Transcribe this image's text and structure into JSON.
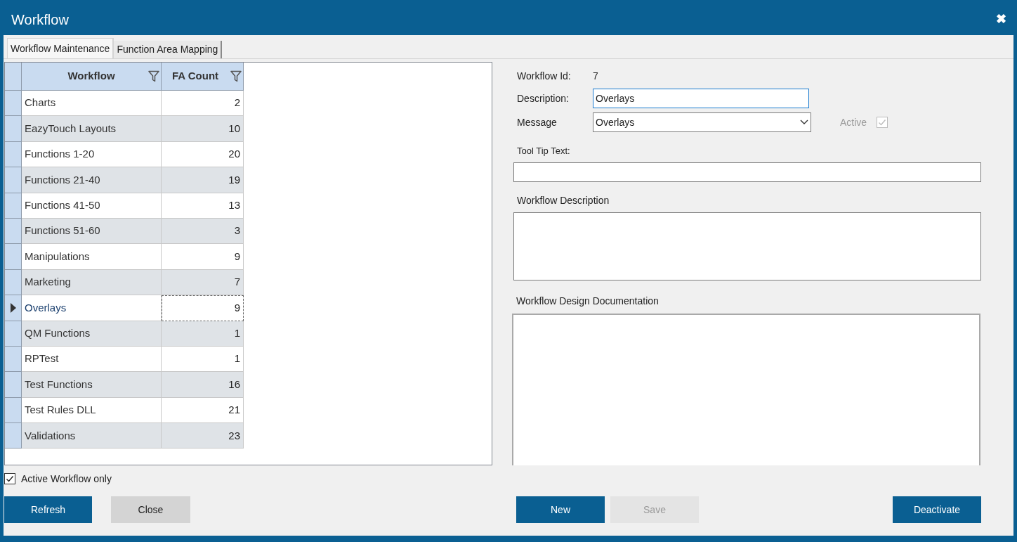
{
  "window": {
    "title": "Workflow",
    "close": "✖"
  },
  "tabs": [
    {
      "label": "Workflow Maintenance",
      "selected": true
    },
    {
      "label": "Function Area Mapping",
      "selected": false
    }
  ],
  "table": {
    "columns": [
      "Workflow",
      "FA Count"
    ],
    "rows": [
      {
        "workflow": "Charts",
        "fa_count": "2",
        "selected": false
      },
      {
        "workflow": "EazyTouch Layouts",
        "fa_count": "10",
        "selected": false
      },
      {
        "workflow": "Functions 1-20",
        "fa_count": "20",
        "selected": false
      },
      {
        "workflow": "Functions 21-40",
        "fa_count": "19",
        "selected": false
      },
      {
        "workflow": "Functions 41-50",
        "fa_count": "13",
        "selected": false
      },
      {
        "workflow": "Functions 51-60",
        "fa_count": "3",
        "selected": false
      },
      {
        "workflow": "Manipulations",
        "fa_count": "9",
        "selected": false
      },
      {
        "workflow": "Marketing",
        "fa_count": "7",
        "selected": false
      },
      {
        "workflow": "Overlays",
        "fa_count": "9",
        "selected": true
      },
      {
        "workflow": "QM Functions",
        "fa_count": "1",
        "selected": false
      },
      {
        "workflow": "RPTest",
        "fa_count": "1",
        "selected": false
      },
      {
        "workflow": "Test Functions",
        "fa_count": "16",
        "selected": false
      },
      {
        "workflow": "Test Rules DLL",
        "fa_count": "21",
        "selected": false
      },
      {
        "workflow": "Validations",
        "fa_count": "23",
        "selected": false
      }
    ]
  },
  "active_only": {
    "label": "Active Workflow only",
    "checked": true
  },
  "form": {
    "workflow_id_label": "Workflow Id:",
    "workflow_id": "7",
    "description_label": "Description:",
    "description": "Overlays",
    "message_label": "Message",
    "message": "Overlays",
    "active": {
      "label": "Active",
      "checked": true,
      "disabled": true
    },
    "tooltip_label": "Tool Tip Text:",
    "workflow_description_label": "Workflow Description",
    "design_doc_label": "Workflow Design Documentation"
  },
  "buttons_left": [
    {
      "label": "Refresh",
      "kind": "primary",
      "disabled": false
    },
    {
      "label": "Close",
      "kind": "secondary",
      "disabled": false
    }
  ],
  "buttons_mid": [
    {
      "label": "New",
      "kind": "primary",
      "disabled": false
    },
    {
      "label": "Save",
      "kind": "primary",
      "disabled": true
    }
  ],
  "buttons_right": [
    {
      "label": "Deactivate",
      "kind": "primary",
      "disabled": false
    }
  ]
}
